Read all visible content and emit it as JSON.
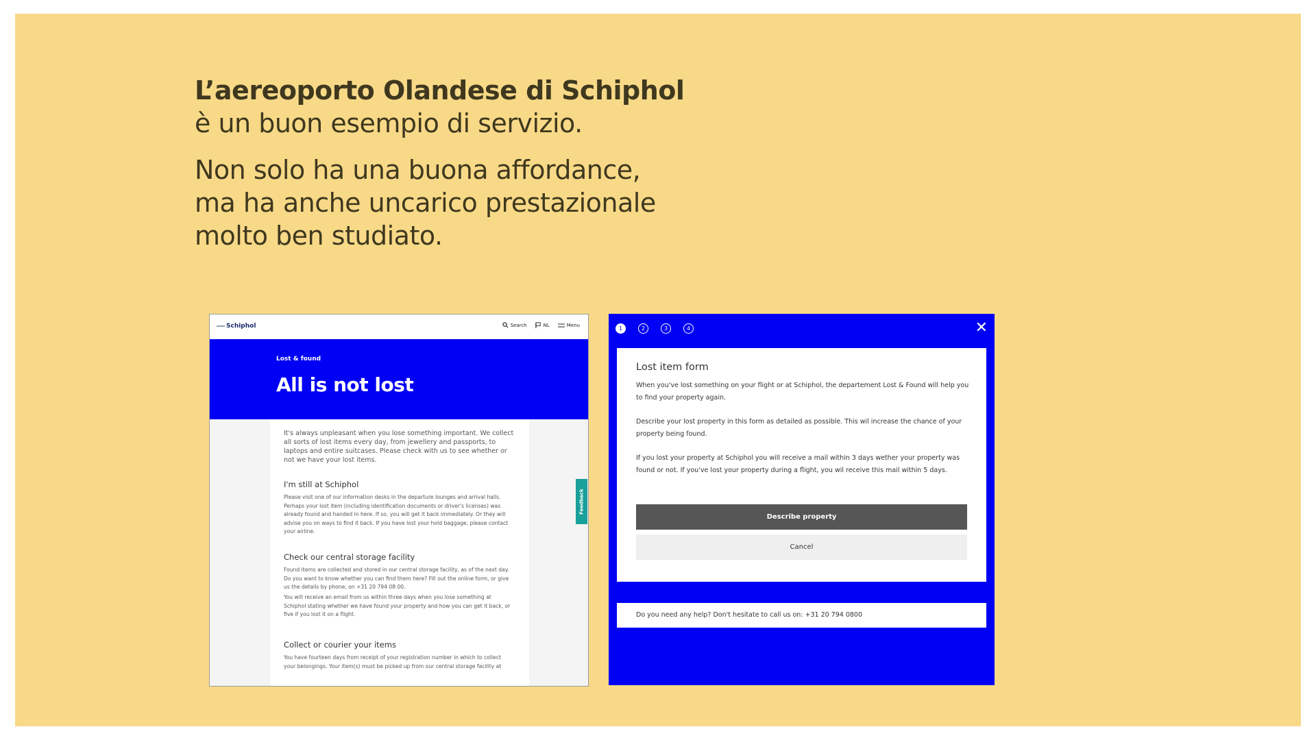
{
  "slide": {
    "title_bold": "L’aereoporto Olandese di Schiphol",
    "line1": "è un buon esempio di servizio.",
    "line2": "Non solo ha una buona affordance,",
    "line3": "ma ha anche uncarico prestazionale",
    "line4": "molto ben studiato."
  },
  "schiphol_page": {
    "logo": "Schiphol",
    "nav": {
      "search": "Search",
      "lang": "NL",
      "menu": "Menu"
    },
    "kicker": "Lost & found",
    "title": "All is not lost",
    "intro": "It's always unpleasant when you lose something important. We collect all sorts of lost items every day, from jewellery and passports, to laptops and entire suitcases. Please check with us to see whether or not we have your lost items.",
    "section1_title": "I'm still at Schiphol",
    "section1_text": "Please visit one of our information desks in the departure lounges and arrival halls. Perhaps your lost item (including identification documents or driver's licenses) was already found and handed in here. If so, you will get it back immediately. Or they will advise you on ways to find it back. If you have lost your hold baggage, please contact your airline.",
    "section2_title": "Check our central storage facility",
    "section2_text": "Found items are collected and stored in our central storage facility, as of the next day. Do you want to know whether you can find them here? Fill out the online form, or give us the details by phone, on +31 20 794 08 00.",
    "section2_text2": "You will receive an email from us within three days when you lose something at Schiphol stating whether we have found your property and how you can get it back, or five if you lost it on a flight.",
    "section3_title": "Collect or courier your items",
    "section3_text": "You have fourteen days from receipt of your registration number in which to collect your belongings. Your item(s) must be picked up from our central storage facility at",
    "feedback": "Feedback"
  },
  "lost_form": {
    "steps": [
      "1",
      "2",
      "3",
      "4"
    ],
    "close": "✕",
    "title": "Lost item form",
    "p1": "When you've lost something on your flight or at Schiphol, the departement Lost & Found will help you to find your property again.",
    "p2": "Describe your lost property in this form as detailed as possible. This wil increase the chance of your property being found.",
    "p3": "If you lost your property at Schiphol you will receive a mail within 3 days wether your property was found or not. If you've lost your property during a flight, you wil receive this mail within 5 days.",
    "primary_button": "Describe property",
    "secondary_button": "Cancel",
    "help": "Do you need any help? Don't hesitate to call us on: +31 20 794 0800"
  }
}
